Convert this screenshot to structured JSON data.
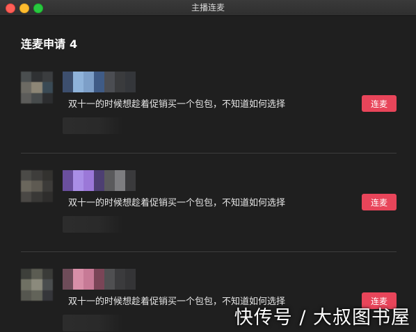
{
  "window": {
    "title": "主播连麦"
  },
  "list": {
    "heading": "连麦申请",
    "count": "4"
  },
  "items": [
    {
      "message": "双十一的时候想趁着促销买一个包包，不知道如何选择",
      "button_label": "连麦",
      "avatar_colors": [
        "#4a4e4f",
        "#2f3133",
        "#3b3d3f",
        "#6c6a63",
        "#8d8676",
        "#3a4a55",
        "#5c5c5a",
        "#474b4c",
        "#2c2d2f"
      ],
      "nick_colors": [
        "#3d4f6e",
        "#8fb3da",
        "#7d9fc8",
        "#3f5b86",
        "#4b4d52",
        "#3a3b3d",
        "#34363a"
      ]
    },
    {
      "message": "双十一的时候想趁着促销买一个包包，不知道如何选择",
      "button_label": "连麦",
      "avatar_colors": [
        "#4b4a47",
        "#3e3d3b",
        "#33322f",
        "#6a665c",
        "#5e5a52",
        "#3c3b39",
        "#4a4845",
        "#393836",
        "#2e2d2c"
      ],
      "nick_colors": [
        "#6a4f9e",
        "#a98ee6",
        "#9b78d8",
        "#4d3f72",
        "#5a5a5c",
        "#7d7d80",
        "#3a3a3c"
      ]
    },
    {
      "message": "双十一的时候想趁着促销买一个包包，不知道如何选择",
      "button_label": "连麦",
      "avatar_colors": [
        "#3d3f3a",
        "#5b5c52",
        "#3a3b38",
        "#6f7063",
        "#8b8a7c",
        "#4a4d4e",
        "#55564f",
        "#626359",
        "#35363a"
      ],
      "nick_colors": [
        "#6e4c59",
        "#d88fa8",
        "#c77a96",
        "#7a4557",
        "#4f4f51",
        "#3b3b3d",
        "#343436"
      ]
    }
  ],
  "watermark": "快传号 / 大叔图书屋",
  "colors": {
    "accent": "#e8455a",
    "background": "#1f1f1f",
    "divider": "#3d3d3d"
  }
}
